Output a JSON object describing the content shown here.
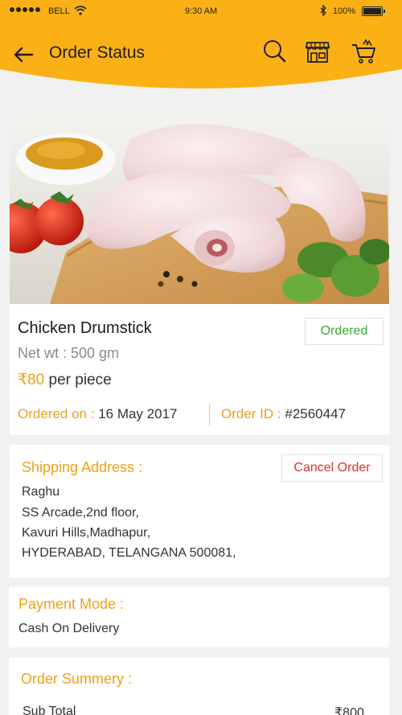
{
  "status_bar": {
    "carrier": "BELL",
    "time": "9:30 AM",
    "battery": "100%"
  },
  "appbar": {
    "title": "Order Status"
  },
  "product": {
    "name": "Chicken Drumstick",
    "net_weight": "Net wt : 500 gm",
    "price": "₹80",
    "price_unit": "per piece",
    "status": "Ordered",
    "ordered_on_label": "Ordered on :",
    "ordered_on_value": "16 May 2017",
    "order_id_label": "Order ID :",
    "order_id_value": "#2560447"
  },
  "shipping": {
    "title": "Shipping Address :",
    "cancel_label": "Cancel Order",
    "lines": [
      "Raghu",
      "SS Arcade,2nd floor,",
      "Kavuri Hills,Madhapur,",
      "HYDERABAD, TELANGANA 500081,"
    ]
  },
  "payment": {
    "title": "Payment Mode :",
    "value": "Cash On Delivery"
  },
  "summary": {
    "title": "Order Summery :",
    "sub_total_label": "Sub Total",
    "sub_total_value": "₹800"
  },
  "colors": {
    "header": "#fbb116",
    "accent": "#f0a019",
    "status_green": "#3aaa35",
    "cancel_red": "#e0302a"
  },
  "icons": [
    "back-arrow-icon",
    "search-icon",
    "store-icon",
    "cart-icon",
    "wifi-icon",
    "bluetooth-icon",
    "battery-icon"
  ]
}
